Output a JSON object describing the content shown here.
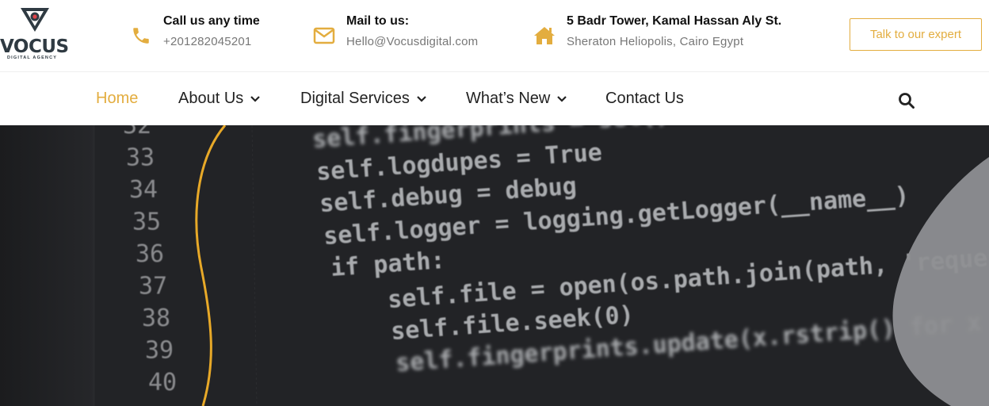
{
  "logo": {
    "word": "VOCUS",
    "tagline": "DIGITAL AGENCY"
  },
  "contacts": [
    {
      "icon": "phone-icon",
      "title": "Call us any time",
      "detail": "+201282045201"
    },
    {
      "icon": "envelope-icon",
      "title": "Mail to us:",
      "detail": "Hello@Vocusdigital.com"
    },
    {
      "icon": "home-icon",
      "title": "5 Badr Tower, Kamal Hassan Aly St.",
      "detail": "Sheraton Heliopolis, Cairo Egypt"
    }
  ],
  "cta": {
    "label": "Talk to our expert"
  },
  "nav": {
    "items": [
      {
        "label": "Home",
        "active": true,
        "dropdown": false
      },
      {
        "label": "About Us",
        "active": false,
        "dropdown": true
      },
      {
        "label": "Digital Services",
        "active": false,
        "dropdown": true
      },
      {
        "label": "What’s New",
        "active": false,
        "dropdown": true
      },
      {
        "label": "Contact Us",
        "active": false,
        "dropdown": false
      }
    ]
  },
  "hero": {
    "line_numbers": [
      "32",
      "33",
      "34",
      "35",
      "36",
      "37",
      "38",
      "39",
      "40"
    ],
    "code_lines": [
      "self.fingerprints = set()",
      "self.logdupes = True",
      "self.debug = debug",
      "self.logger = logging.getLogger(__name__)",
      "if path:",
      "self.file = open(os.path.join(path, 'requests.seen'), 'a+')",
      "self.file.seek(0)",
      "self.fingerprints.update(x.rstrip() for x in self.file)"
    ]
  },
  "colors": {
    "accent": "#e3ad3f",
    "dark": "#202124",
    "text": "#222222"
  }
}
